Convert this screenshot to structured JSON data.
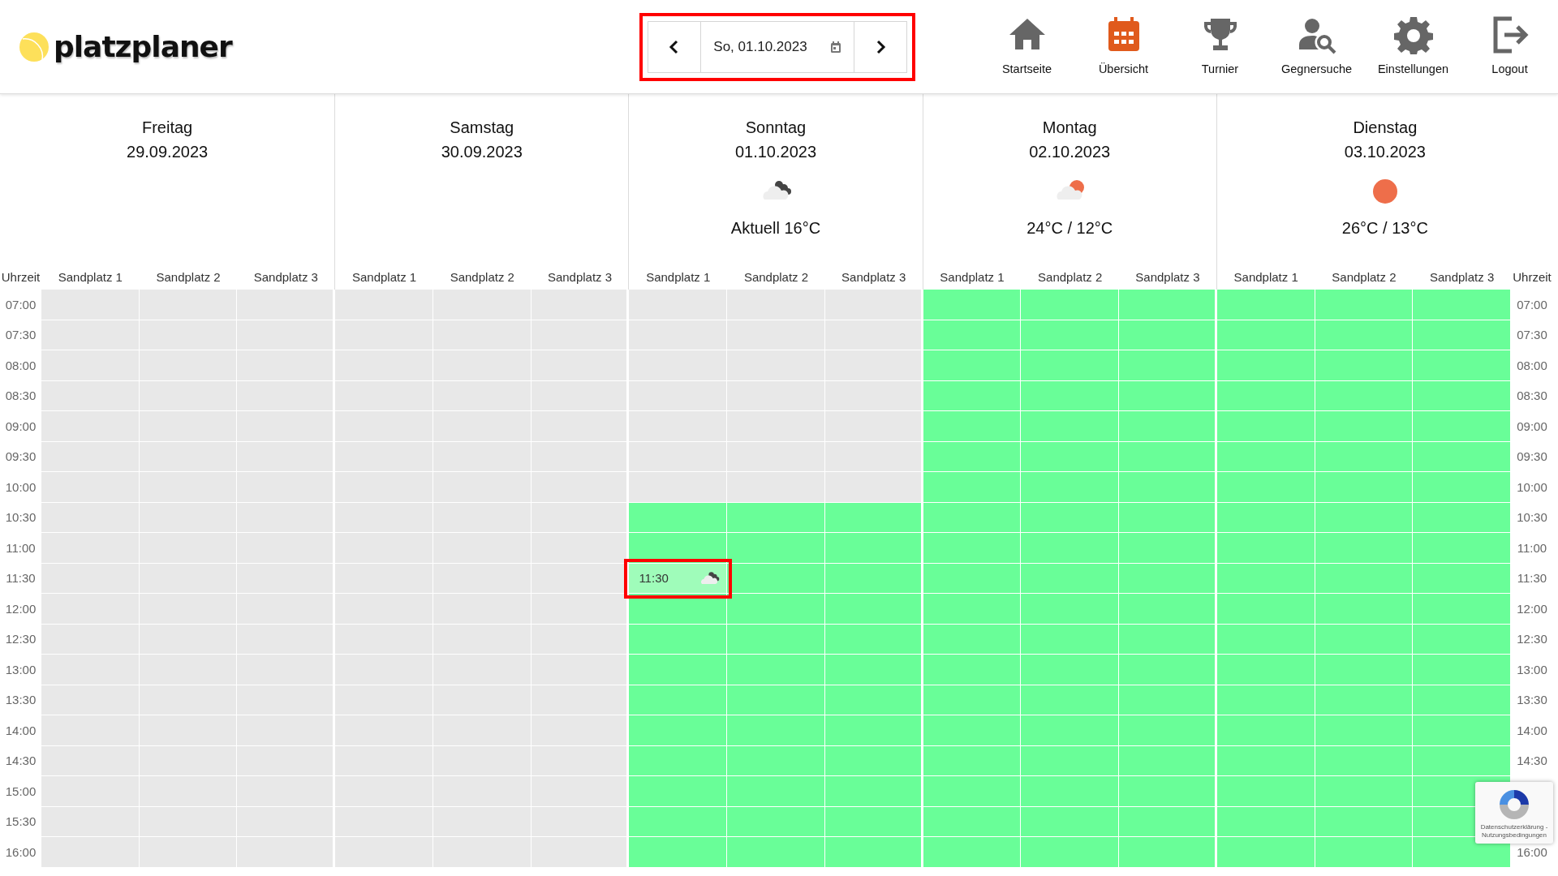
{
  "header": {
    "logo": "platzplaner",
    "date_nav": {
      "date": "So, 01.10.2023",
      "highlighted": true
    },
    "nav": [
      {
        "label": "Startseite",
        "selected": false
      },
      {
        "label": "Übersicht",
        "selected": true
      },
      {
        "label": "Turnier",
        "selected": false
      },
      {
        "label": "Gegnersuche",
        "selected": false
      },
      {
        "label": "Einstellungen",
        "selected": false
      },
      {
        "label": "Logout",
        "selected": false
      }
    ]
  },
  "schedule": {
    "time_heading_left": "Uhrzeit",
    "time_heading_right": "Uhrzeit",
    "days": [
      {
        "name": "Freitag",
        "date": "29.09.2023",
        "courts": [
          "Sandplatz 1",
          "Sandplatz 2",
          "Sandplatz 3"
        ]
      },
      {
        "name": "Samstag",
        "date": "30.09.2023",
        "courts": [
          "Sandplatz 1",
          "Sandplatz 2",
          "Sandplatz 3"
        ]
      },
      {
        "name": "Sonntag",
        "date": "01.10.2023",
        "weather": {
          "kind": "cloudy",
          "temperature": "Aktuell 16°C"
        },
        "courts": [
          "Sandplatz 1",
          "Sandplatz 2",
          "Sandplatz 3"
        ]
      },
      {
        "name": "Montag",
        "date": "02.10.2023",
        "weather": {
          "kind": "partly-sunny",
          "temperature": "24°C / 12°C"
        },
        "courts": [
          "Sandplatz 1",
          "Sandplatz 2",
          "Sandplatz 3"
        ]
      },
      {
        "name": "Dienstag",
        "date": "03.10.2023",
        "weather": {
          "kind": "sunny",
          "temperature": "26°C / 13°C"
        },
        "courts": [
          "Sandplatz 1",
          "Sandplatz 2",
          "Sandplatz 3"
        ]
      }
    ],
    "rows": [
      {
        "time": "07:00",
        "time_right": "07:00",
        "cells": [
          {
            "free": false
          },
          {
            "free": false
          },
          {
            "free": false
          },
          {
            "free": false
          },
          {
            "free": false
          },
          {
            "free": false
          },
          {
            "free": false
          },
          {
            "free": false
          },
          {
            "free": false
          },
          {
            "free": true
          },
          {
            "free": true
          },
          {
            "free": true
          },
          {
            "free": true
          },
          {
            "free": true
          },
          {
            "free": true
          }
        ]
      },
      {
        "time": "07:30",
        "time_right": "07:30",
        "cells": [
          {
            "free": false
          },
          {
            "free": false
          },
          {
            "free": false
          },
          {
            "free": false
          },
          {
            "free": false
          },
          {
            "free": false
          },
          {
            "free": false
          },
          {
            "free": false
          },
          {
            "free": false
          },
          {
            "free": true
          },
          {
            "free": true
          },
          {
            "free": true
          },
          {
            "free": true
          },
          {
            "free": true
          },
          {
            "free": true
          }
        ]
      },
      {
        "time": "08:00",
        "time_right": "08:00",
        "cells": [
          {
            "free": false
          },
          {
            "free": false
          },
          {
            "free": false
          },
          {
            "free": false
          },
          {
            "free": false
          },
          {
            "free": false
          },
          {
            "free": false
          },
          {
            "free": false
          },
          {
            "free": false
          },
          {
            "free": true
          },
          {
            "free": true
          },
          {
            "free": true
          },
          {
            "free": true
          },
          {
            "free": true
          },
          {
            "free": true
          }
        ]
      },
      {
        "time": "08:30",
        "time_right": "08:30",
        "cells": [
          {
            "free": false
          },
          {
            "free": false
          },
          {
            "free": false
          },
          {
            "free": false
          },
          {
            "free": false
          },
          {
            "free": false
          },
          {
            "free": false
          },
          {
            "free": false
          },
          {
            "free": false
          },
          {
            "free": true
          },
          {
            "free": true
          },
          {
            "free": true
          },
          {
            "free": true
          },
          {
            "free": true
          },
          {
            "free": true
          }
        ]
      },
      {
        "time": "09:00",
        "time_right": "09:00",
        "cells": [
          {
            "free": false
          },
          {
            "free": false
          },
          {
            "free": false
          },
          {
            "free": false
          },
          {
            "free": false
          },
          {
            "free": false
          },
          {
            "free": false
          },
          {
            "free": false
          },
          {
            "free": false
          },
          {
            "free": true
          },
          {
            "free": true
          },
          {
            "free": true
          },
          {
            "free": true
          },
          {
            "free": true
          },
          {
            "free": true
          }
        ]
      },
      {
        "time": "09:30",
        "time_right": "09:30",
        "cells": [
          {
            "free": false
          },
          {
            "free": false
          },
          {
            "free": false
          },
          {
            "free": false
          },
          {
            "free": false
          },
          {
            "free": false
          },
          {
            "free": false
          },
          {
            "free": false
          },
          {
            "free": false
          },
          {
            "free": true
          },
          {
            "free": true
          },
          {
            "free": true
          },
          {
            "free": true
          },
          {
            "free": true
          },
          {
            "free": true
          }
        ]
      },
      {
        "time": "10:00",
        "time_right": "10:00",
        "cells": [
          {
            "free": false
          },
          {
            "free": false
          },
          {
            "free": false
          },
          {
            "free": false
          },
          {
            "free": false
          },
          {
            "free": false
          },
          {
            "free": false
          },
          {
            "free": false
          },
          {
            "free": false
          },
          {
            "free": true
          },
          {
            "free": true
          },
          {
            "free": true
          },
          {
            "free": true
          },
          {
            "free": true
          },
          {
            "free": true
          }
        ]
      },
      {
        "time": "10:30",
        "time_right": "10:30",
        "cells": [
          {
            "free": false
          },
          {
            "free": false
          },
          {
            "free": false
          },
          {
            "free": false
          },
          {
            "free": false
          },
          {
            "free": false
          },
          {
            "free": true
          },
          {
            "free": true
          },
          {
            "free": true
          },
          {
            "free": true
          },
          {
            "free": true
          },
          {
            "free": true
          },
          {
            "free": true
          },
          {
            "free": true
          },
          {
            "free": true
          }
        ]
      },
      {
        "time": "11:00",
        "time_right": "11:00",
        "cells": [
          {
            "free": false
          },
          {
            "free": false
          },
          {
            "free": false
          },
          {
            "free": false
          },
          {
            "free": false
          },
          {
            "free": false
          },
          {
            "free": true
          },
          {
            "free": true
          },
          {
            "free": true
          },
          {
            "free": true
          },
          {
            "free": true
          },
          {
            "free": true
          },
          {
            "free": true
          },
          {
            "free": true
          },
          {
            "free": true
          }
        ]
      },
      {
        "time": "11:30",
        "time_right": "11:30",
        "cells": [
          {
            "free": false
          },
          {
            "free": false
          },
          {
            "free": false
          },
          {
            "free": false
          },
          {
            "free": false
          },
          {
            "free": false
          },
          {
            "free": true,
            "hover": {
              "label": "11:30",
              "weather": {
                "kind": "cloudy"
              },
              "highlighted": true
            }
          },
          {
            "free": true
          },
          {
            "free": true
          },
          {
            "free": true
          },
          {
            "free": true
          },
          {
            "free": true
          },
          {
            "free": true
          },
          {
            "free": true
          },
          {
            "free": true
          }
        ]
      },
      {
        "time": "12:00",
        "time_right": "12:00",
        "cells": [
          {
            "free": false
          },
          {
            "free": false
          },
          {
            "free": false
          },
          {
            "free": false
          },
          {
            "free": false
          },
          {
            "free": false
          },
          {
            "free": true
          },
          {
            "free": true
          },
          {
            "free": true
          },
          {
            "free": true
          },
          {
            "free": true
          },
          {
            "free": true
          },
          {
            "free": true
          },
          {
            "free": true
          },
          {
            "free": true
          }
        ]
      },
      {
        "time": "12:30",
        "time_right": "12:30",
        "cells": [
          {
            "free": false
          },
          {
            "free": false
          },
          {
            "free": false
          },
          {
            "free": false
          },
          {
            "free": false
          },
          {
            "free": false
          },
          {
            "free": true
          },
          {
            "free": true
          },
          {
            "free": true
          },
          {
            "free": true
          },
          {
            "free": true
          },
          {
            "free": true
          },
          {
            "free": true
          },
          {
            "free": true
          },
          {
            "free": true
          }
        ]
      },
      {
        "time": "13:00",
        "time_right": "13:00",
        "cells": [
          {
            "free": false
          },
          {
            "free": false
          },
          {
            "free": false
          },
          {
            "free": false
          },
          {
            "free": false
          },
          {
            "free": false
          },
          {
            "free": true
          },
          {
            "free": true
          },
          {
            "free": true
          },
          {
            "free": true
          },
          {
            "free": true
          },
          {
            "free": true
          },
          {
            "free": true
          },
          {
            "free": true
          },
          {
            "free": true
          }
        ]
      },
      {
        "time": "13:30",
        "time_right": "13:30",
        "cells": [
          {
            "free": false
          },
          {
            "free": false
          },
          {
            "free": false
          },
          {
            "free": false
          },
          {
            "free": false
          },
          {
            "free": false
          },
          {
            "free": true
          },
          {
            "free": true
          },
          {
            "free": true
          },
          {
            "free": true
          },
          {
            "free": true
          },
          {
            "free": true
          },
          {
            "free": true
          },
          {
            "free": true
          },
          {
            "free": true
          }
        ]
      },
      {
        "time": "14:00",
        "time_right": "14:00",
        "cells": [
          {
            "free": false
          },
          {
            "free": false
          },
          {
            "free": false
          },
          {
            "free": false
          },
          {
            "free": false
          },
          {
            "free": false
          },
          {
            "free": true
          },
          {
            "free": true
          },
          {
            "free": true
          },
          {
            "free": true
          },
          {
            "free": true
          },
          {
            "free": true
          },
          {
            "free": true
          },
          {
            "free": true
          },
          {
            "free": true
          }
        ]
      },
      {
        "time": "14:30",
        "time_right": "14:30",
        "cells": [
          {
            "free": false
          },
          {
            "free": false
          },
          {
            "free": false
          },
          {
            "free": false
          },
          {
            "free": false
          },
          {
            "free": false
          },
          {
            "free": true
          },
          {
            "free": true
          },
          {
            "free": true
          },
          {
            "free": true
          },
          {
            "free": true
          },
          {
            "free": true
          },
          {
            "free": true
          },
          {
            "free": true
          },
          {
            "free": true
          }
        ]
      },
      {
        "time": "15:00",
        "cells": [
          {
            "free": false
          },
          {
            "free": false
          },
          {
            "free": false
          },
          {
            "free": false
          },
          {
            "free": false
          },
          {
            "free": false
          },
          {
            "free": true
          },
          {
            "free": true
          },
          {
            "free": true
          },
          {
            "free": true
          },
          {
            "free": true
          },
          {
            "free": true
          },
          {
            "free": true
          },
          {
            "free": true
          },
          {
            "free": true
          }
        ]
      },
      {
        "time": "15:30",
        "cells": [
          {
            "free": false
          },
          {
            "free": false
          },
          {
            "free": false
          },
          {
            "free": false
          },
          {
            "free": false
          },
          {
            "free": false
          },
          {
            "free": true
          },
          {
            "free": true
          },
          {
            "free": true
          },
          {
            "free": true
          },
          {
            "free": true
          },
          {
            "free": true
          },
          {
            "free": true
          },
          {
            "free": true
          },
          {
            "free": true
          }
        ]
      },
      {
        "time": "16:00",
        "time_right": "16:00",
        "cells": [
          {
            "free": false
          },
          {
            "free": false
          },
          {
            "free": false
          },
          {
            "free": false
          },
          {
            "free": false
          },
          {
            "free": false
          },
          {
            "free": true
          },
          {
            "free": true
          },
          {
            "free": true
          },
          {
            "free": true
          },
          {
            "free": true
          },
          {
            "free": true
          },
          {
            "free": true
          },
          {
            "free": true
          },
          {
            "free": true
          }
        ]
      }
    ]
  },
  "recaptcha": {
    "links": "Datenschutzerklärung - Nutzungsbedingungen"
  }
}
